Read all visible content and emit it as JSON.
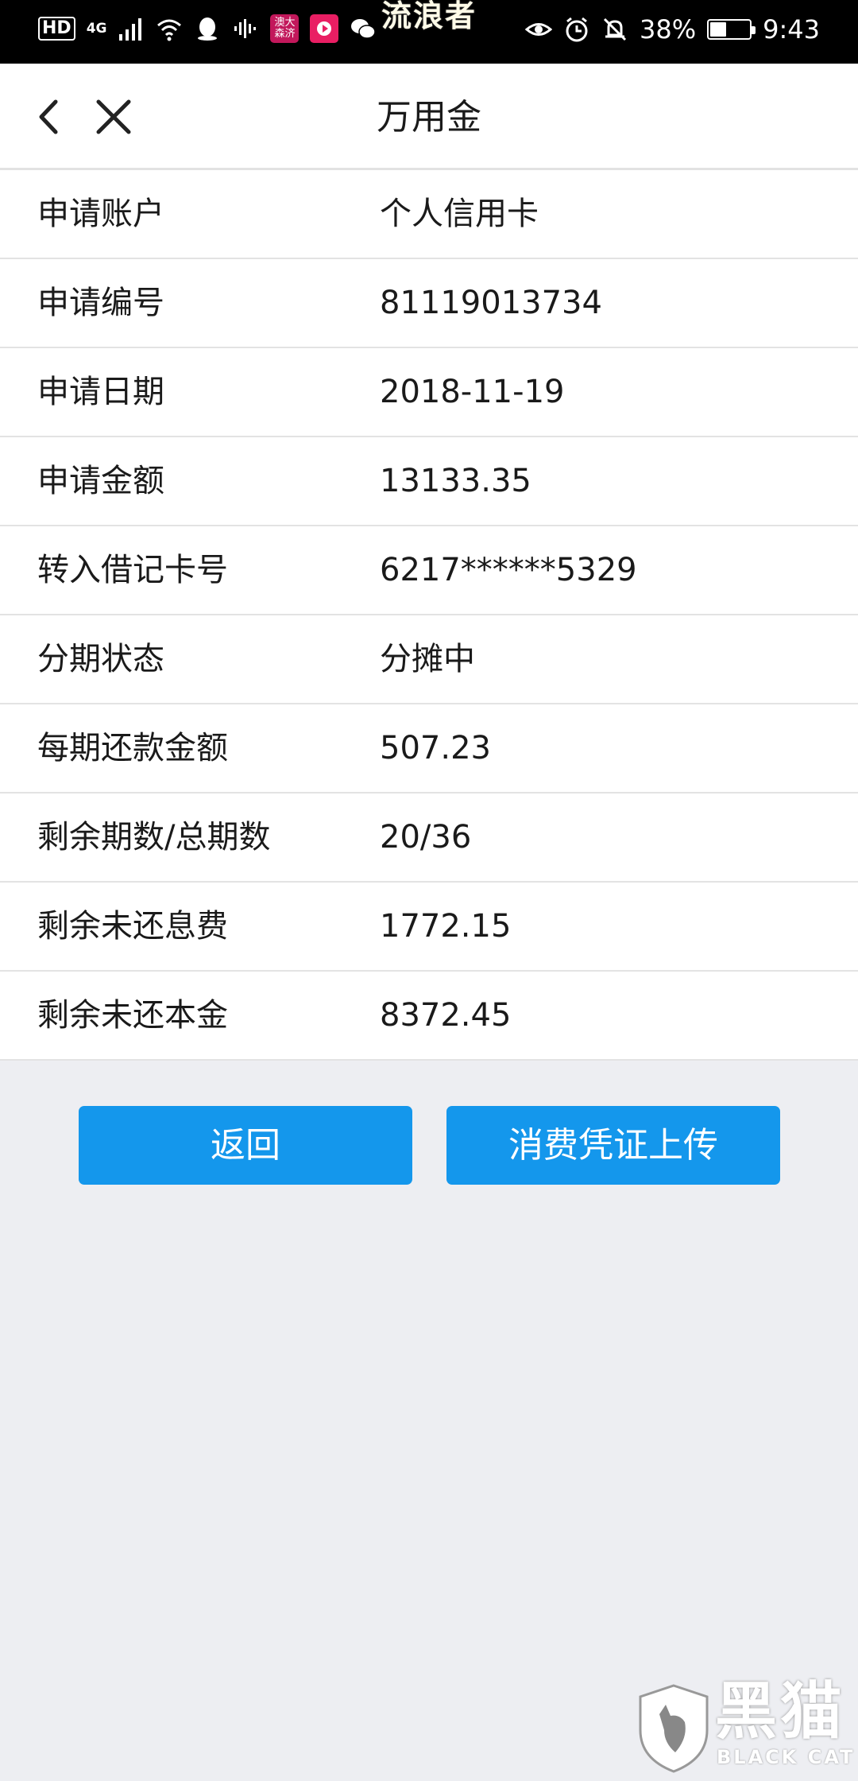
{
  "status_bar": {
    "hd_label": "HD",
    "network_label": "4G",
    "app_badge_text": "澳大\n森济",
    "center_text": "流浪者",
    "battery_percent": "38%",
    "battery_level": 0.38,
    "time": "9:43"
  },
  "nav": {
    "title": "万用金"
  },
  "details": [
    {
      "label": "申请账户",
      "value": "个人信用卡"
    },
    {
      "label": "申请编号",
      "value": "81119013734"
    },
    {
      "label": "申请日期",
      "value": "2018-11-19"
    },
    {
      "label": "申请金额",
      "value": "13133.35"
    },
    {
      "label": "转入借记卡号",
      "value": "6217******5329"
    },
    {
      "label": "分期状态",
      "value": "分摊中"
    },
    {
      "label": "每期还款金额",
      "value": "507.23"
    },
    {
      "label": "剩余期数/总期数",
      "value": "20/36"
    },
    {
      "label": "剩余未还息费",
      "value": "1772.15"
    },
    {
      "label": "剩余未还本金",
      "value": "8372.45"
    }
  ],
  "actions": {
    "back_label": "返回",
    "upload_label": "消费凭证上传"
  },
  "watermark": {
    "text": "黑猫",
    "sub": "BLACK CAT"
  },
  "colors": {
    "button": "#1497ec",
    "background": "#edeef2",
    "status_bar": "#000000"
  }
}
